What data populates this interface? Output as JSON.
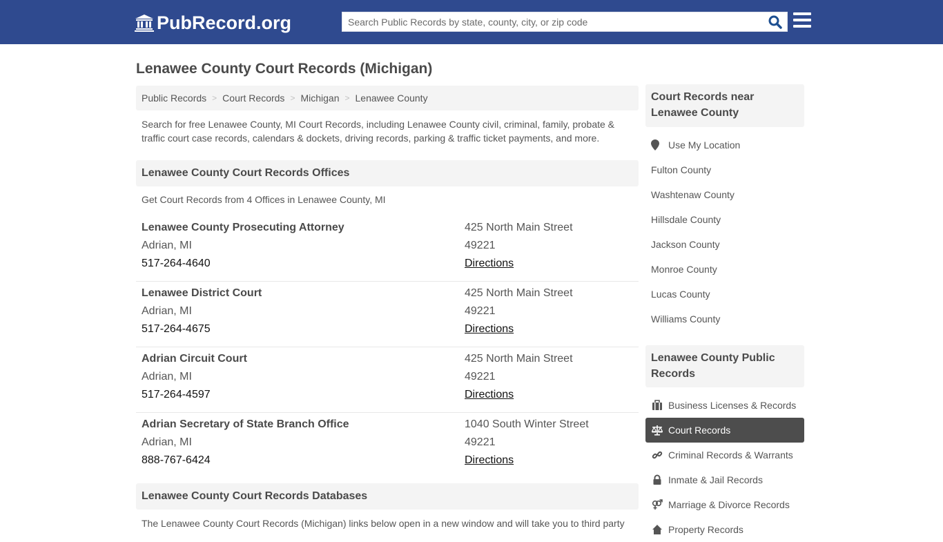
{
  "header": {
    "logo_text": "PubRecord.org",
    "search_placeholder": "Search Public Records by state, county, city, or zip code",
    "search_value": ""
  },
  "page": {
    "title": "Lenawee County Court Records (Michigan)"
  },
  "breadcrumb": [
    {
      "label": "Public Records"
    },
    {
      "label": "Court Records"
    },
    {
      "label": "Michigan"
    },
    {
      "label": "Lenawee County"
    }
  ],
  "breadcrumb_separator": ">",
  "intro": "Search for free Lenawee County, MI Court Records, including Lenawee County civil, criminal, family, probate & traffic court case records, calendars & dockets, driving records, parking & traffic ticket payments, and more.",
  "offices_section": {
    "heading": "Lenawee County Court Records Offices",
    "note": "Get Court Records from 4 Offices in Lenawee County, MI",
    "offices": [
      {
        "name": "Lenawee County Prosecuting Attorney",
        "city": "Adrian, MI",
        "phone": "517-264-4640",
        "street": "425 North Main Street",
        "zip": "49221",
        "directions_label": "Directions"
      },
      {
        "name": "Lenawee District Court",
        "city": "Adrian, MI",
        "phone": "517-264-4675",
        "street": "425 North Main Street",
        "zip": "49221",
        "directions_label": "Directions"
      },
      {
        "name": "Adrian Circuit Court",
        "city": "Adrian, MI",
        "phone": "517-264-4597",
        "street": "425 North Main Street",
        "zip": "49221",
        "directions_label": "Directions"
      },
      {
        "name": "Adrian Secretary of State Branch Office",
        "city": "Adrian, MI",
        "phone": "888-767-6424",
        "street": "1040 South Winter Street",
        "zip": "49221",
        "directions_label": "Directions"
      }
    ]
  },
  "databases_section": {
    "heading": "Lenawee County Court Records Databases",
    "text": "The Lenawee County Court Records (Michigan) links below open in a new window and will take you to third party"
  },
  "sidebar": {
    "nearby": {
      "heading": "Court Records near Lenawee County",
      "use_location": {
        "label": "Use My Location",
        "icon": "map-marker-icon"
      },
      "counties": [
        {
          "label": "Fulton County"
        },
        {
          "label": "Washtenaw County"
        },
        {
          "label": "Hillsdale County"
        },
        {
          "label": "Jackson County"
        },
        {
          "label": "Monroe County"
        },
        {
          "label": "Lucas County"
        },
        {
          "label": "Williams County"
        }
      ]
    },
    "public_records": {
      "heading": "Lenawee County Public Records",
      "items": [
        {
          "label": "Business Licenses & Records",
          "icon": "briefcase-icon",
          "active": false
        },
        {
          "label": "Court Records",
          "icon": "balance-scale-icon",
          "active": true
        },
        {
          "label": "Criminal Records & Warrants",
          "icon": "link-icon",
          "active": false
        },
        {
          "label": "Inmate & Jail Records",
          "icon": "lock-icon",
          "active": false
        },
        {
          "label": "Marriage & Divorce Records",
          "icon": "venus-mars-icon",
          "active": false
        },
        {
          "label": "Property Records",
          "icon": "home-icon",
          "active": false
        }
      ]
    }
  },
  "colors": {
    "navbar": "#2f4a8f",
    "search_icon": "#1d4f91",
    "panel_bg": "#f4f4f4",
    "active_item_bg": "#4d4d4d"
  }
}
